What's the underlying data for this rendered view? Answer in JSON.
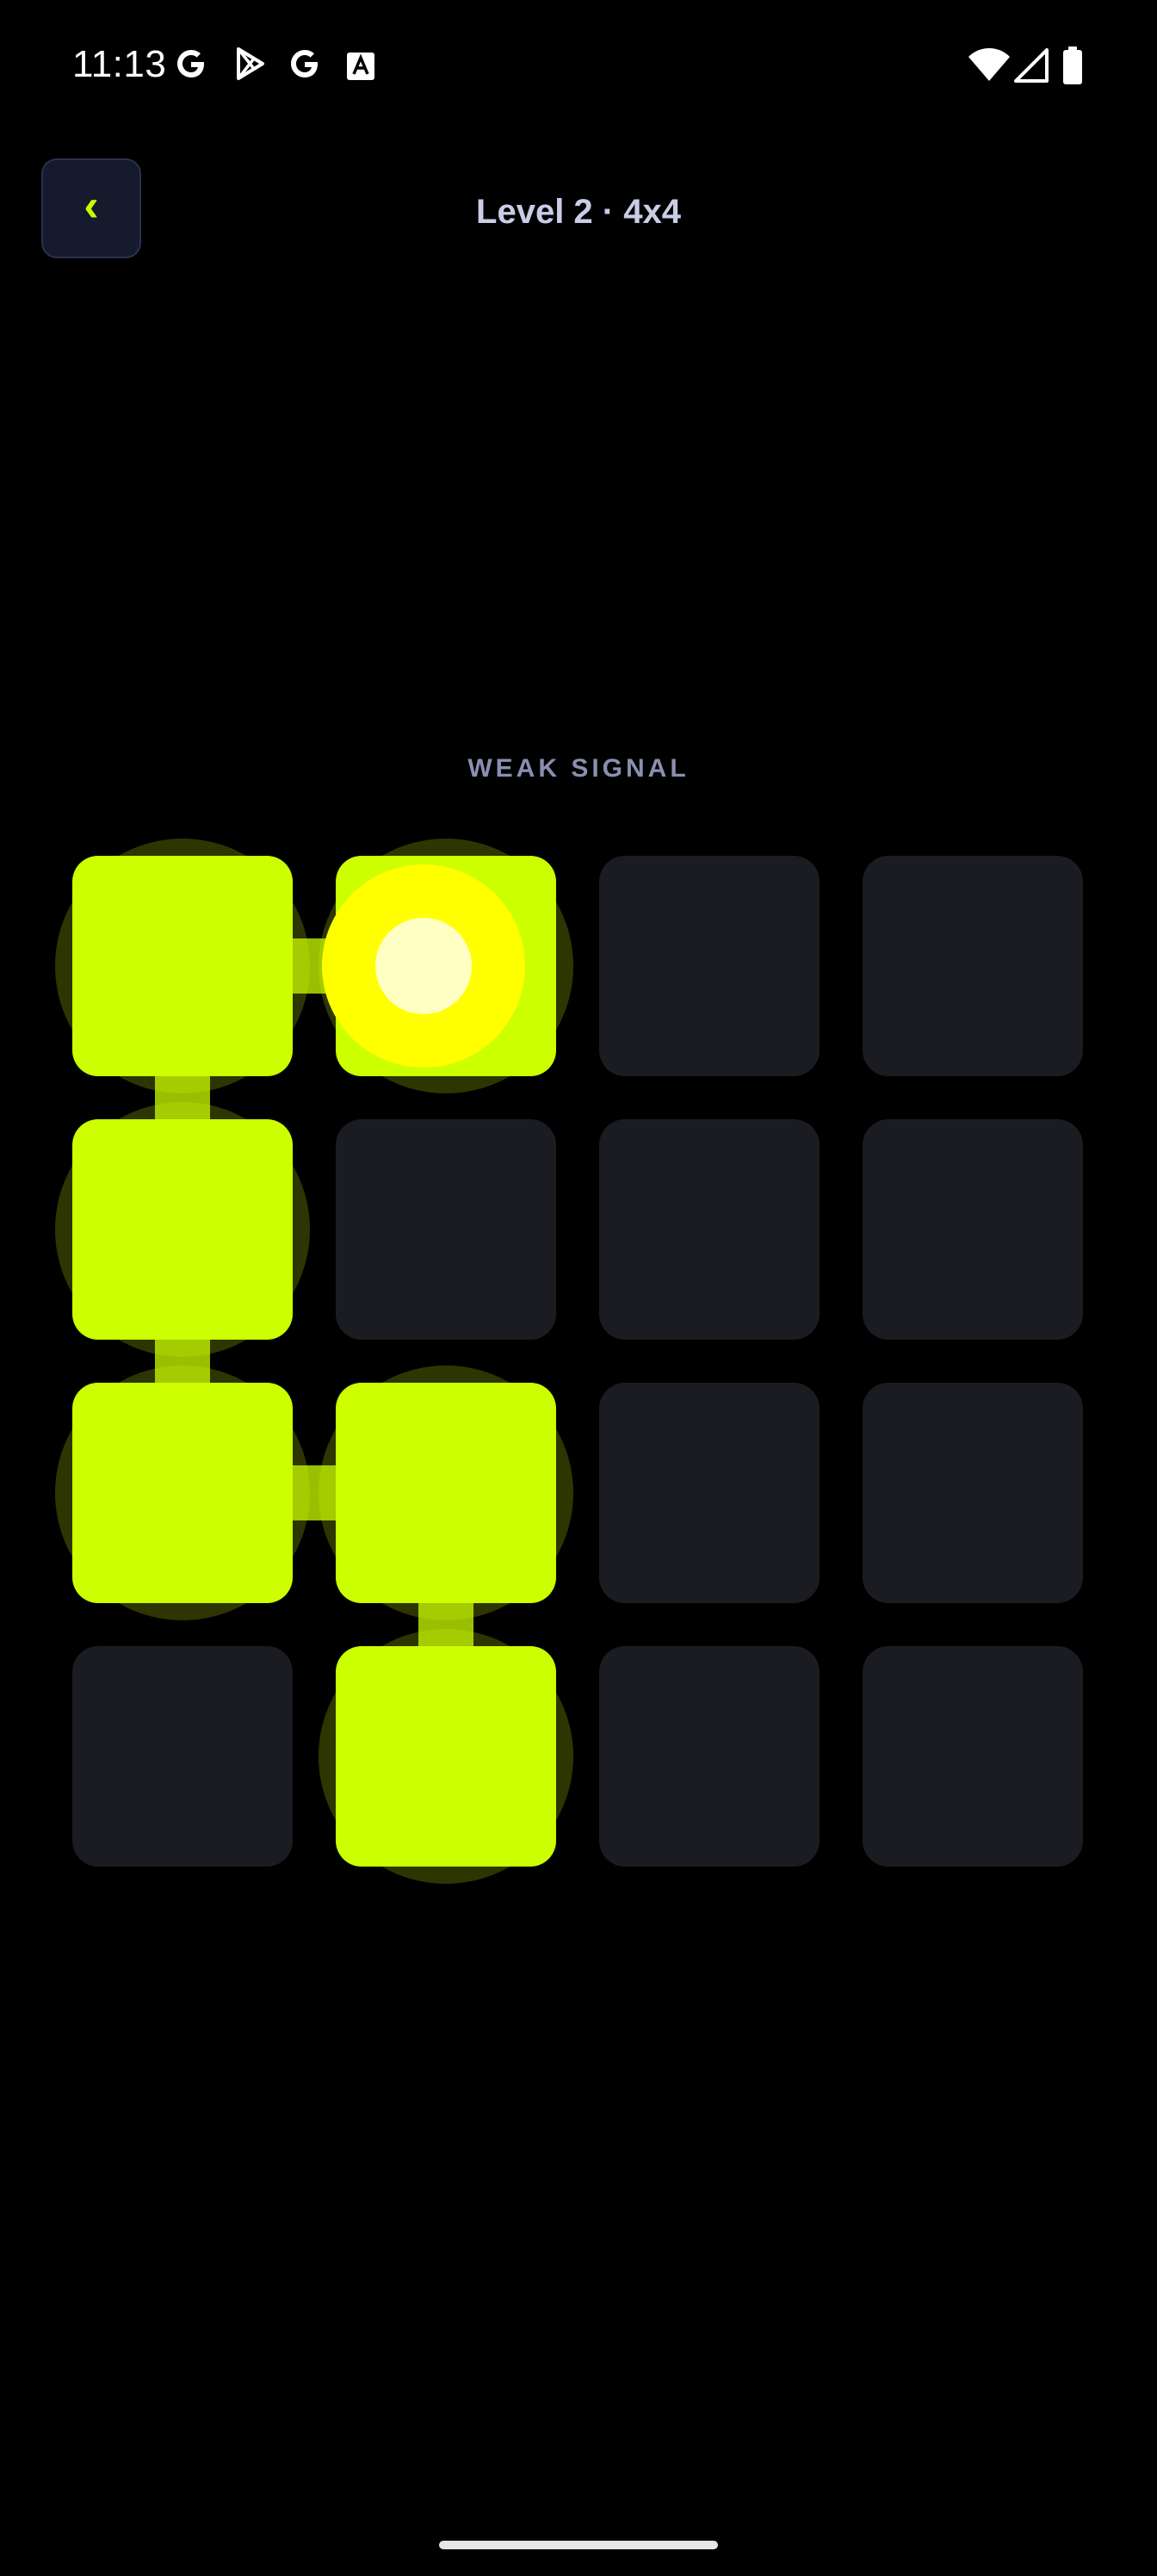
{
  "status_bar": {
    "time": "11:13",
    "notification_icons": [
      "google-icon",
      "play-store-icon",
      "google-icon",
      "font-icon"
    ],
    "system_icons": [
      "wifi-icon",
      "cellular-signal-icon",
      "battery-icon"
    ]
  },
  "header": {
    "back_label": "‹",
    "title": "Level 2 · 4x4"
  },
  "game": {
    "signal_label": "WEAK SIGNAL",
    "grid_size": 4,
    "lit_cells": [
      [
        0,
        0
      ],
      [
        0,
        1
      ],
      [
        1,
        0
      ],
      [
        2,
        0
      ],
      [
        2,
        1
      ],
      [
        3,
        1
      ]
    ],
    "connections": [
      [
        [
          0,
          0
        ],
        [
          0,
          1
        ]
      ],
      [
        [
          0,
          0
        ],
        [
          1,
          0
        ]
      ],
      [
        [
          1,
          0
        ],
        [
          2,
          0
        ]
      ],
      [
        [
          2,
          0
        ],
        [
          2,
          1
        ]
      ],
      [
        [
          2,
          1
        ],
        [
          3,
          1
        ]
      ]
    ],
    "source_cell": [
      0,
      1
    ],
    "colors": {
      "lit": "#ccff00",
      "unlit": "#1b1c21",
      "halo": "#2d3600",
      "source": "#ffff00",
      "source_core": "#ffffc4",
      "accent": "#c8ff00",
      "label": "#8a8fb0",
      "title": "#c9cde6"
    }
  }
}
